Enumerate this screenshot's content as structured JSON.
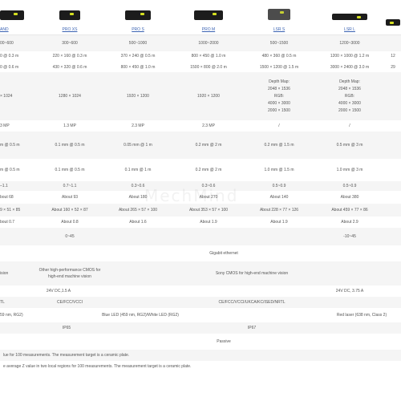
{
  "products": [
    {
      "name": "AND",
      "img": "dark-camera"
    },
    {
      "name": "PRO XS",
      "img": "dark-camera"
    },
    {
      "name": "PRO S",
      "img": "dark-camera"
    },
    {
      "name": "PRO M",
      "img": "dark-camera"
    },
    {
      "name": "LSR S",
      "img": "gray-camera"
    },
    {
      "name": "LSR L",
      "img": "dark-camera"
    }
  ],
  "rows": {
    "distance": [
      "00~600",
      "300~600",
      "500~1000",
      "1000~2000",
      "500~1500",
      "1200~3000",
      ""
    ],
    "fov_near": [
      "0 @ 0.3 m",
      "220 × 160 @ 0.3 m",
      "370 × 240 @ 0.5 m",
      "800 × 450 @ 1.0 m",
      "480 × 360 @ 0.5 m",
      "1200 × 1000 @ 1.2 m",
      "12"
    ],
    "fov_far": [
      "0 @ 0.6 m",
      "430 × 320 @ 0.6 m",
      "800 × 450 @ 1.0 m",
      "1500 × 800 @ 2.0 m",
      "1500 × 1200 @ 1.5 m",
      "3000 × 2400 @ 3.0 m",
      "29"
    ],
    "resolution": [
      " × 1024",
      "1280 × 1024",
      "1920 × 1200",
      "1920 × 1200",
      "",
      "",
      ""
    ],
    "res_lsr_s": [
      "Depth Map:",
      "2048 × 1536",
      "RGB:",
      "4000 × 3000",
      "2000 × 1500"
    ],
    "res_lsr_l": [
      "Depth Map:",
      "2048 × 1536",
      "RGB:",
      "4000 × 3000",
      "2000 × 1500"
    ],
    "megapixel": [
      "3 MP",
      "1.3 MP",
      "2.3 MP",
      "2.3 MP",
      "/",
      "/",
      ""
    ],
    "z_repeat": [
      "m @ 0.5 m",
      "0.1 mm @ 0.5 m",
      "0.05 mm @ 1 m",
      "0.2 mm @ 2 m",
      "0.2 mm @ 1.5 m",
      "0.5 mm @ 3 m",
      ""
    ],
    "vdi": [
      "m @ 0.5 m",
      "0.1 mm @ 0.5 m",
      "0.1 mm @ 1 m",
      "0.2 mm @ 2 m",
      "1.0 mm @ 1.5 m",
      "1.0 mm @ 3 m",
      ""
    ],
    "time": [
      "–1.1",
      "0.7~1.1",
      "0.3~0.6",
      "0.3~0.6",
      "0.5~0.9",
      "0.5~0.9",
      ""
    ],
    "baseline": [
      "bout 68",
      "About 93",
      "About 180",
      "About 270",
      "About 140",
      "About 380",
      ""
    ],
    "dimensions": [
      "9 × 51 × 85",
      "About 160 × 52 × 87",
      "About 265 × 57 × 100",
      "About 353 × 57 × 100",
      "About 228 × 77 × 126",
      "About 459 × 77 × 86",
      ""
    ],
    "weight": [
      "bout 0.7",
      "About 0.8",
      "About 1.6",
      "About 1.9",
      "About 1.9",
      "About 2.9",
      ""
    ],
    "temp_a": "0~45",
    "temp_b": "-10~45",
    "data_interface": "Gigabit ethernet",
    "sensor_a": "ision",
    "sensor_b": "Other high-performance CMOS for high-end machine vision",
    "sensor_c": "Sony CMOS for high-end machine vision",
    "power_a": "24V DC,1.5 A",
    "power_b": "24V DC, 3.75 A",
    "cert_a": "TL",
    "cert_b": "CE/FCC/VCCI",
    "cert_c": "CE/FCC/VCCI/UKCA/KC/ISED/NRTL",
    "light_a": "59 nm, RG2)",
    "light_b": "Blue LED (459 nm, RG2)/White LED (RG2)",
    "light_c": "Red laser (638 nm, Class 2)",
    "ip_a": "IP65",
    "ip_b": "IP67",
    "cooling": "Passive"
  },
  "notes": [
    "lue for 100 measurements. The measurement target is a ceramic plate.",
    "e average Z value in two local regions for 100 measurements. The measurement target is a ceramic plate."
  ],
  "watermark": "MechMind"
}
